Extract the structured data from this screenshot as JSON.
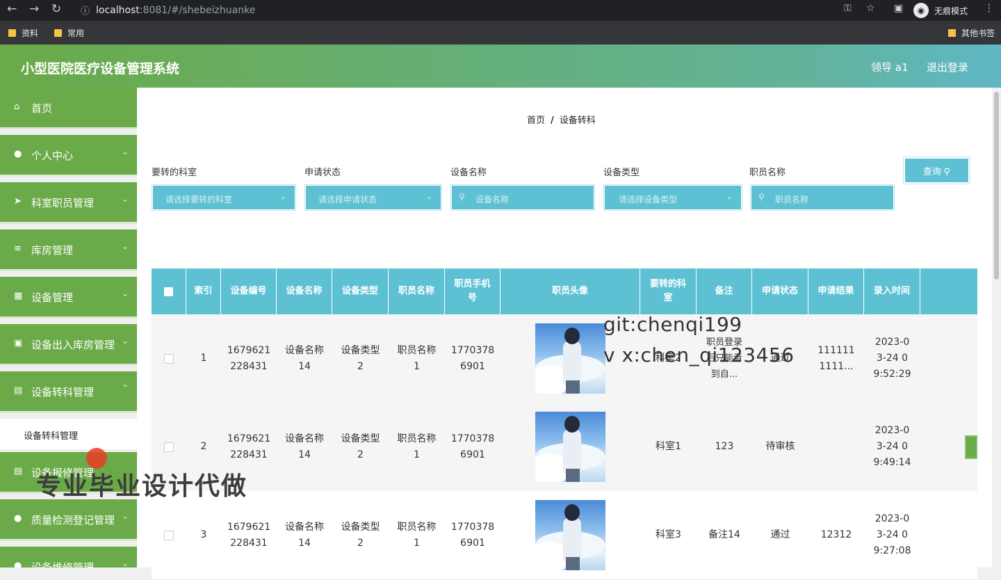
{
  "browser": {
    "url_host": "localhost",
    "url_port_path": ":8081/#/shebeizhuanke",
    "incognito_label": "无痕模式",
    "bookmarks": [
      "资料",
      "常用"
    ],
    "other_bookmarks": "其他书签"
  },
  "header": {
    "title": "小型医院医疗设备管理系统",
    "user": "领导 a1",
    "logout": "退出登录"
  },
  "sidebar": {
    "items": [
      {
        "label": "首页",
        "icon": "home-icon"
      },
      {
        "label": "个人中心",
        "icon": "user-icon"
      },
      {
        "label": "科室职员管理",
        "icon": "send-icon"
      },
      {
        "label": "库房管理",
        "icon": "list-icon"
      },
      {
        "label": "设备管理",
        "icon": "grid-icon"
      },
      {
        "label": "设备出入库房管理",
        "icon": "box-icon"
      },
      {
        "label": "设备转科管理",
        "icon": "clipboard-icon"
      },
      {
        "label": "设备报修管理",
        "icon": "clipboard-icon"
      },
      {
        "label": "质量检测登记管理",
        "icon": "user-icon"
      },
      {
        "label": "设备维修管理",
        "icon": "user-icon"
      }
    ],
    "sub_item": "设备转科管理"
  },
  "breadcrumb": {
    "home": "首页",
    "sep": "/",
    "current": "设备转科"
  },
  "filters": {
    "dept": {
      "label": "要转的科室",
      "placeholder": "请选择要转的科室"
    },
    "status": {
      "label": "申请状态",
      "placeholder": "请选择申请状态"
    },
    "device_name": {
      "label": "设备名称",
      "placeholder": "设备名称"
    },
    "device_type": {
      "label": "设备类型",
      "placeholder": "请选择设备类型"
    },
    "staff_name": {
      "label": "职员名称",
      "placeholder": "职员名称"
    },
    "query_label": "查询"
  },
  "table": {
    "columns": [
      "索引",
      "设备编号",
      "设备名称",
      "设备类型",
      "职员名称",
      "职员手机号",
      "职员头像",
      "要转的科室",
      "备注",
      "申请状态",
      "申请结果",
      "录入时间"
    ],
    "rows": [
      {
        "index": "1",
        "code": "1679621228431",
        "name": "设备名称14",
        "type": "设备类型2",
        "staff": "职员名称1",
        "phone": "17703786901",
        "dept": "科室2",
        "note": "职员登录后只能看到自...",
        "status": "通过",
        "result": "1111111111...",
        "time": "2023-03-24 09:52:29"
      },
      {
        "index": "2",
        "code": "1679621228431",
        "name": "设备名称14",
        "type": "设备类型2",
        "staff": "职员名称1",
        "phone": "17703786901",
        "dept": "科室1",
        "note": "123",
        "status": "待审核",
        "result": "",
        "time": "2023-03-24 09:49:14"
      },
      {
        "index": "3",
        "code": "1679621228431",
        "name": "设备名称14",
        "type": "设备类型2",
        "staff": "职员名称1",
        "phone": "17703786901",
        "dept": "科室3",
        "note": "备注14",
        "status": "通过",
        "result": "12312",
        "time": "2023-03-24 09:27:08"
      }
    ]
  },
  "watermarks": {
    "git": "git:chenqi199",
    "vx": "v x:chen_qi123456",
    "cn": "专业毕业设计代做"
  },
  "colors": {
    "green": "#6aaa48",
    "teal": "#5ec1d3"
  }
}
